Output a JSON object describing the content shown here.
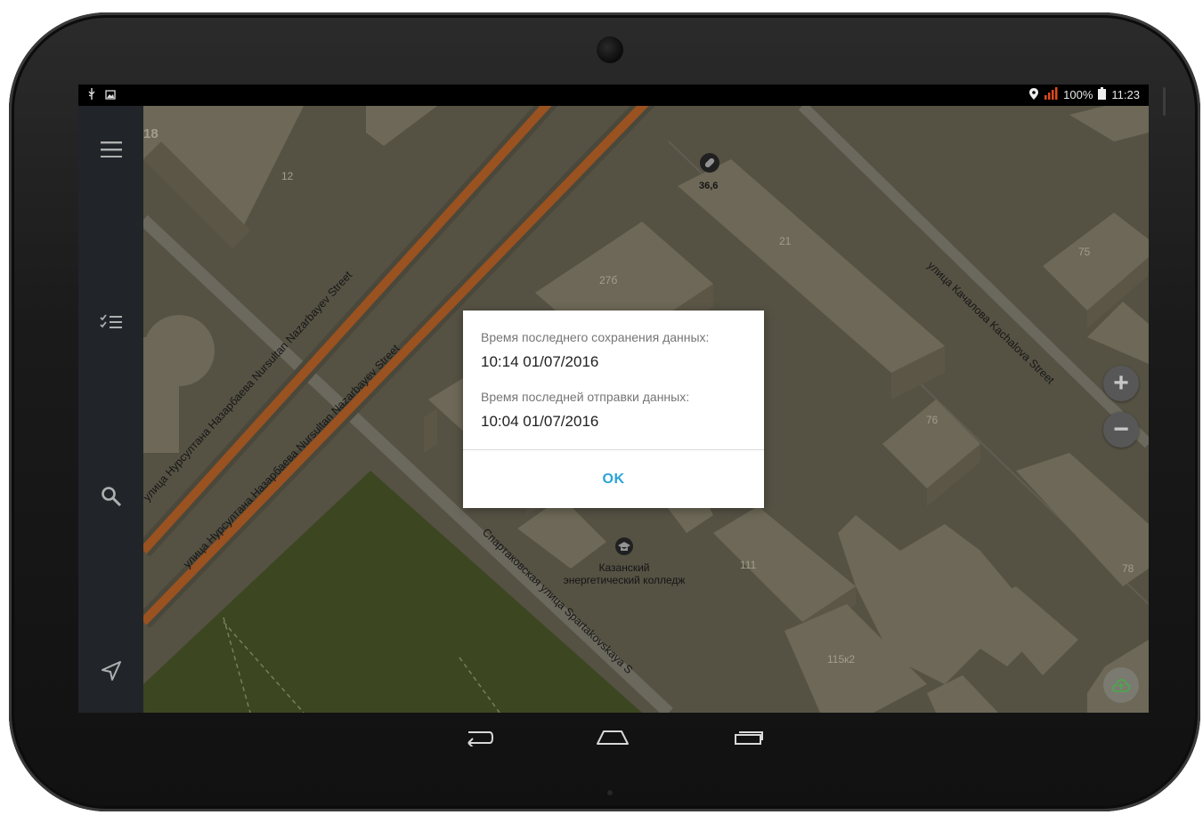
{
  "status_bar": {
    "battery": "100%",
    "time": "11:23",
    "icons_left": [
      "usb-icon",
      "image-icon"
    ],
    "icons_right": [
      "location-icon",
      "signal-icon",
      "battery-icon"
    ]
  },
  "sidebar": {
    "items": [
      {
        "name": "menu",
        "icon": "hamburger-menu-icon"
      },
      {
        "name": "tasks",
        "icon": "checklist-icon"
      },
      {
        "name": "search",
        "icon": "search-icon"
      },
      {
        "name": "navigate",
        "icon": "navigation-arrow-icon"
      }
    ]
  },
  "map": {
    "building_numbers": [
      "18",
      "12",
      "21",
      "75",
      "27б",
      "76",
      "111",
      "78",
      "115к2",
      "36,6"
    ],
    "streets": [
      "улица Нурсултана Назарбаева  Nursultan Nazarbayev Street",
      "улица Нурсултана Назарбаева  Nursultan Nazarbayev Street",
      "улица Качалова  Kachalova Street",
      "Спартаковская улица  Spartakovskaya S"
    ],
    "poi": {
      "line1": "Казанский",
      "line2": "энергетический колледж"
    },
    "zoom_in": "+",
    "zoom_out": "−"
  },
  "dialog": {
    "label_saved": "Время последнего сохранения данных:",
    "value_saved": "10:14 01/07/2016",
    "label_sent": "Время последней отправки данных:",
    "value_sent": "10:04 01/07/2016",
    "ok_label": "OK"
  },
  "colors": {
    "sidebar_bg": "#2b3036",
    "dialog_accent": "#2aa3d8",
    "road_orange": "#c5692a",
    "park_green": "#4e5a2b",
    "map_bg": "#6e6a58"
  }
}
